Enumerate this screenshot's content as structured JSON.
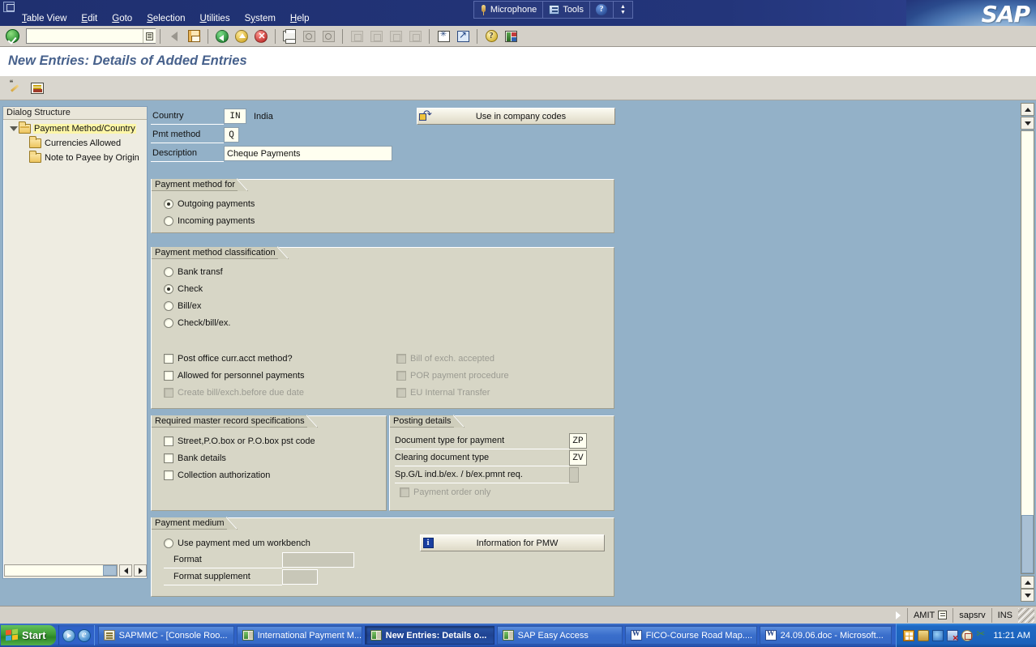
{
  "window": {
    "titlebar_icons": [
      "minimize",
      "restore",
      "close"
    ],
    "brand": "SAP"
  },
  "menubar": {
    "items": [
      {
        "label": "Table View",
        "accel": "T"
      },
      {
        "label": "Edit",
        "accel": "E"
      },
      {
        "label": "Goto",
        "accel": "G"
      },
      {
        "label": "Selection",
        "accel": "S"
      },
      {
        "label": "Utilities",
        "accel": "U"
      },
      {
        "label": "System",
        "accel": "y"
      },
      {
        "label": "Help",
        "accel": "H"
      }
    ],
    "tools": {
      "microphone_label": "Microphone",
      "tools_label": "Tools",
      "help_glyph": "?",
      "spinner_glyph": "▴▾"
    }
  },
  "toolbar": {
    "command_value": "",
    "command_placeholder": "",
    "icons": [
      {
        "name": "ok-enter-icon",
        "title": "Enter"
      },
      {
        "name": "prev-arrow-icon",
        "title": "Previous"
      },
      {
        "name": "save-icon",
        "title": "Save"
      },
      {
        "name": "back-icon",
        "title": "Back"
      },
      {
        "name": "exit-icon",
        "title": "Exit"
      },
      {
        "name": "cancel-icon",
        "title": "Cancel"
      },
      {
        "name": "print-icon",
        "title": "Print"
      },
      {
        "name": "find-icon",
        "title": "Find"
      },
      {
        "name": "find-next-icon",
        "title": "Find Next"
      },
      {
        "name": "first-page-icon",
        "title": "First Page"
      },
      {
        "name": "previous-page-icon",
        "title": "Previous Page"
      },
      {
        "name": "next-page-icon",
        "title": "Next Page"
      },
      {
        "name": "last-page-icon",
        "title": "Last Page"
      },
      {
        "name": "create-session-icon",
        "title": "Create New Session"
      },
      {
        "name": "create-shortcut-icon",
        "title": "Create Shortcut"
      },
      {
        "name": "help-icon",
        "title": "Help"
      },
      {
        "name": "customize-layout-icon",
        "title": "Customize Local Layout"
      }
    ]
  },
  "page": {
    "title": "New Entries: Details of Added Entries"
  },
  "app_toolbar": {
    "icons": [
      {
        "name": "new-entries-icon",
        "title": "New Entries"
      },
      {
        "name": "display-details-icon",
        "title": "Display Details"
      }
    ]
  },
  "dialog_structure": {
    "header": "Dialog Structure",
    "items": [
      {
        "label": "Payment Method/Country",
        "level": 0,
        "selected": true,
        "expanded": true
      },
      {
        "label": "Currencies Allowed",
        "level": 1,
        "selected": false,
        "expanded": false
      },
      {
        "label": "Note to Payee by Origin",
        "level": 1,
        "selected": false,
        "expanded": false
      }
    ]
  },
  "header_form": {
    "country_label": "Country",
    "country_value": "IN",
    "country_text": "India",
    "pmt_method_label": "Pmt method",
    "pmt_method_value": "Q",
    "description_label": "Description",
    "description_value": "Cheque Payments",
    "use_company_codes_button": "Use in company codes"
  },
  "payment_method_for": {
    "title": "Payment method for",
    "options": [
      {
        "label": "Outgoing payments",
        "selected": true
      },
      {
        "label": "Incoming payments",
        "selected": false
      }
    ]
  },
  "payment_method_classification": {
    "title": "Payment method classification",
    "options": [
      {
        "label": "Bank transf",
        "selected": false
      },
      {
        "label": "Check",
        "selected": true
      },
      {
        "label": "Bill/ex",
        "selected": false
      },
      {
        "label": "Check/bill/ex.",
        "selected": false
      }
    ],
    "checkboxes_left": [
      {
        "label": "Post office curr.acct method?",
        "checked": false,
        "disabled": false
      },
      {
        "label": "Allowed for personnel payments",
        "checked": false,
        "disabled": false
      },
      {
        "label": "Create bill/exch.before due date",
        "checked": false,
        "disabled": true
      }
    ],
    "checkboxes_right": [
      {
        "label": "Bill of exch. accepted",
        "checked": false,
        "disabled": true
      },
      {
        "label": "POR payment procedure",
        "checked": false,
        "disabled": true
      },
      {
        "label": "EU Internal Transfer",
        "checked": false,
        "disabled": true
      }
    ]
  },
  "required_master_record": {
    "title": "Required master record specifications",
    "checkboxes": [
      {
        "label": "Street,P.O.box or P.O.box pst code",
        "checked": false,
        "disabled": false
      },
      {
        "label": "Bank details",
        "checked": false,
        "disabled": false
      },
      {
        "label": "Collection authorization",
        "checked": false,
        "disabled": false
      }
    ]
  },
  "posting_details": {
    "title": "Posting details",
    "rows": [
      {
        "label": "Document type for payment",
        "value": "ZP",
        "disabled": false
      },
      {
        "label": "Clearing document type",
        "value": "ZV",
        "disabled": false
      },
      {
        "label": "Sp.G/L ind.b/ex. / b/ex.pmnt req.",
        "value": "",
        "disabled": false
      }
    ],
    "checkbox": {
      "label": "Payment order only",
      "checked": false,
      "disabled": true
    }
  },
  "payment_medium": {
    "title": "Payment medium",
    "radio": {
      "label": "Use payment med um workbench",
      "selected": false
    },
    "format_label": "Format",
    "format_value": "",
    "format_supplement_label": "Format supplement",
    "format_supplement_value": "",
    "info_button": "Information for PMW"
  },
  "status_bar": {
    "user": "AMIT",
    "server": "sapsrv",
    "insert_mode": "INS"
  },
  "taskbar": {
    "start_label": "Start",
    "quick_launch": [
      {
        "name": "media-player-icon"
      },
      {
        "name": "internet-explorer-icon"
      }
    ],
    "tasks": [
      {
        "label": "SAPMMC - [Console Roo...",
        "icon": "sapmmc-icon",
        "active": false
      },
      {
        "label": "International Payment M...",
        "icon": "sapgui-icon",
        "active": false
      },
      {
        "label": "New Entries: Details o...",
        "icon": "sapgui-icon",
        "active": true
      },
      {
        "label": "SAP Easy Access",
        "icon": "sapgui-icon",
        "active": false
      },
      {
        "label": "FICO-Course Road Map....",
        "icon": "word-icon",
        "active": false
      },
      {
        "label": "24.09.06.doc - Microsoft...",
        "icon": "word-icon",
        "active": false
      }
    ],
    "tray_icons": [
      {
        "name": "network-icon"
      },
      {
        "name": "folder-tray-icon"
      },
      {
        "name": "bluetooth-icon"
      },
      {
        "name": "volume-muted-icon"
      },
      {
        "name": "mail-icon"
      },
      {
        "name": "safely-remove-icon"
      }
    ],
    "time": "11:21 AM"
  },
  "colors": {
    "titlebar": "#23357a",
    "workspace": "#93b1c8",
    "groupbox": "#d7d6c6",
    "toolbar": "#d4d0c8",
    "field": "#fffff0",
    "title_text": "#47618c",
    "tree_select": "#fdf6a8"
  }
}
